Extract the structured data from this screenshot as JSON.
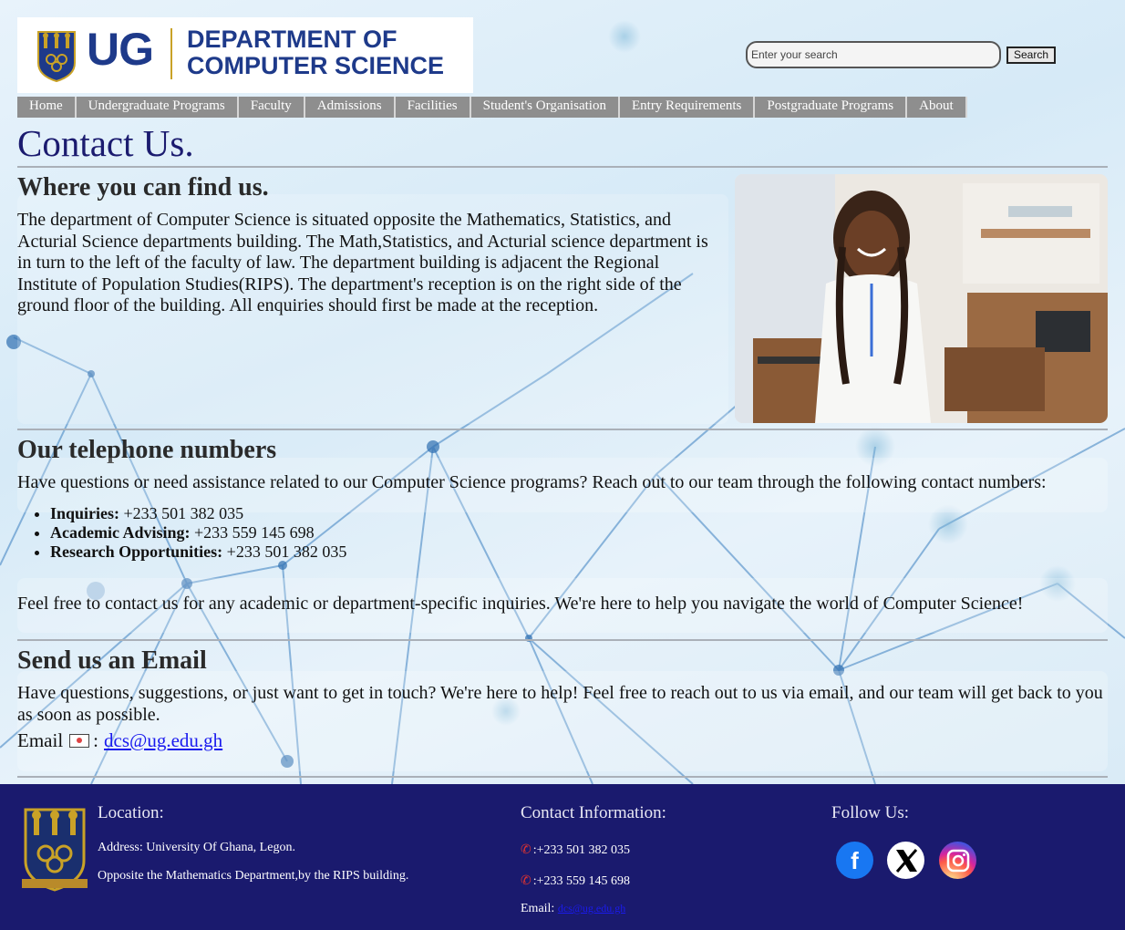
{
  "header": {
    "logo_ug": "UG",
    "logo_line1": "DEPARTMENT OF",
    "logo_line2": "COMPUTER SCIENCE"
  },
  "search": {
    "placeholder": "Enter your search",
    "button_label": "Search"
  },
  "nav": {
    "items": [
      "Home",
      "Undergraduate Programs",
      "Faculty",
      "Admissions",
      "Facilities",
      "Student's Organisation",
      "Entry Requirements",
      "Postgraduate Programs",
      "About"
    ]
  },
  "page": {
    "title": "Contact Us."
  },
  "location": {
    "heading": "Where you can find us.",
    "text": "The department of Computer Science is situated opposite the Mathematics, Statistics, and Acturial Science departments building. The Math,Statistics, and Acturial science department is in turn to the left of the faculty of law. The department building is adjacent the Regional Institute of Population Studies(RIPS). The department's reception is on the right side of the ground floor of the building. All enquiries should first be made at the reception."
  },
  "phones": {
    "heading": "Our telephone numbers",
    "intro": "Have questions or need assistance related to our Computer Science programs? Reach out to our team through the following contact numbers:",
    "items": [
      {
        "label": "Inquiries:",
        "value": " +233 501 382 035"
      },
      {
        "label": "Academic Advising:",
        "value": " +233 559 145 698"
      },
      {
        "label": "Research Opportunities:",
        "value": " +233 501 382 035"
      }
    ],
    "closing": "Feel free to contact us for any academic or department-specific inquiries. We're here to help you navigate the world of Computer Science!"
  },
  "email": {
    "heading": "Send us an Email",
    "text": "Have questions, suggestions, or just want to get in touch? We're here to help! Feel free to reach out to us via email, and our team will get back to you as soon as possible.",
    "label": "Email",
    "separator": ":",
    "address": "dcs@ug.edu.gh"
  },
  "footer": {
    "location_heading": "Location:",
    "address": "Address: University Of Ghana, Legon.",
    "landmark": "Opposite the Mathematics Department,by the RIPS building.",
    "contact_heading": "Contact Information:",
    "phone1": ":+233 501 382 035",
    "phone2": ":+233 559 145 698",
    "email_label": "Email:",
    "email_address": "dcs@ug.edu.gh",
    "follow_heading": "Follow Us:"
  },
  "colors": {
    "nav_bg": "#8e8e8e",
    "footer_bg": "#1a1a6e",
    "brand_blue": "#1e3a8a",
    "title_color": "#1b1b6f"
  }
}
